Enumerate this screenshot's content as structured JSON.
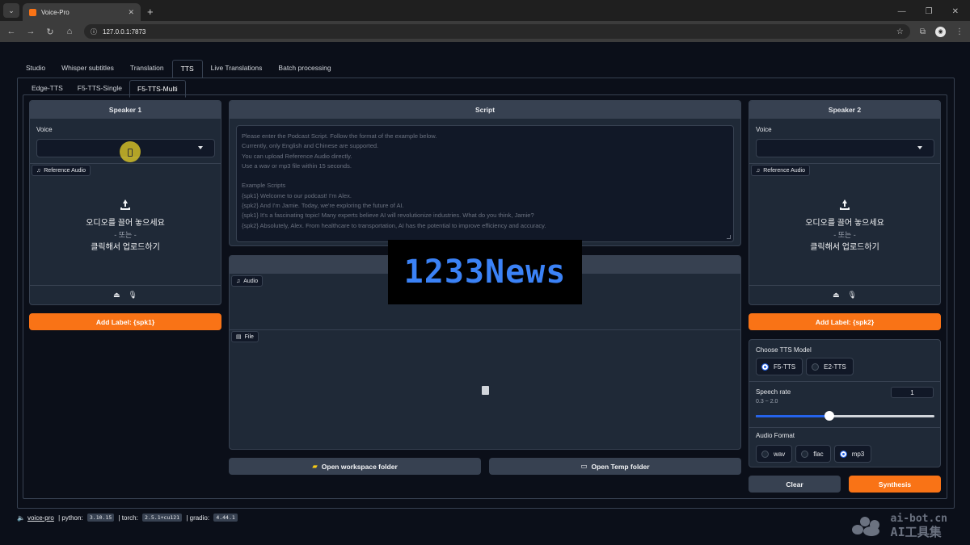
{
  "browser": {
    "tab_title": "Voice-Pro",
    "url": "127.0.0.1:7873"
  },
  "main_tabs": [
    {
      "label": "Studio"
    },
    {
      "label": "Whisper subtitles"
    },
    {
      "label": "Translation"
    },
    {
      "label": "TTS",
      "active": true
    },
    {
      "label": "Live Translations"
    },
    {
      "label": "Batch processing"
    }
  ],
  "sub_tabs": [
    {
      "label": "Edge-TTS"
    },
    {
      "label": "F5-TTS-Single"
    },
    {
      "label": "F5-TTS-Multi",
      "active": true
    }
  ],
  "speaker1": {
    "title": "Speaker 1",
    "voice_label": "Voice",
    "ref_audio_label": "Reference Audio",
    "drop_text": "오디오를 끌어 놓으세요",
    "or_text": "- 또는 -",
    "click_text": "클릭해서 업로드하기",
    "add_label_button": "Add Label: {spk1}"
  },
  "speaker2": {
    "title": "Speaker 2",
    "voice_label": "Voice",
    "ref_audio_label": "Reference Audio",
    "drop_text": "오디오를 끌어 놓으세요",
    "or_text": "- 또는 -",
    "click_text": "클릭해서 업로드하기",
    "add_label_button": "Add Label: {spk2}"
  },
  "script": {
    "title": "Script",
    "placeholder": "Please enter the Podcast Script. Follow the format of the example below.\nCurrently, only English and Chinese are supported.\nYou can upload Reference Audio directly.\nUse a wav or mp3 file within 15 seconds.\n\nExample Scripts\n{spk1} Welcome to our podcast! I'm Alex.\n{spk2} And I'm Jamie. Today, we're exploring the future of AI.\n{spk1} It's a fascinating topic! Many experts believe AI will revolutionize industries. What do you think, Jamie?\n{spk2} Absolutely, Alex. From healthcare to transportation, AI has the potential to improve efficiency and accuracy."
  },
  "output": {
    "audio_label": "Audio",
    "file_label": "File"
  },
  "overlay_watermark": "1233News",
  "buttons": {
    "open_workspace": "Open workspace folder",
    "open_temp": "Open Temp folder",
    "clear": "Clear",
    "synthesis": "Synthesis"
  },
  "settings": {
    "model_label": "Choose TTS Model",
    "models": [
      {
        "label": "F5-TTS",
        "selected": true
      },
      {
        "label": "E2-TTS",
        "selected": false
      }
    ],
    "speech_rate_label": "Speech rate",
    "speech_rate_range": "0.3 ~ 2.0",
    "speech_rate_value": "1",
    "speech_rate_min": 0.3,
    "speech_rate_max": 2.0,
    "audio_format_label": "Audio Format",
    "formats": [
      {
        "label": "wav",
        "selected": false
      },
      {
        "label": "flac",
        "selected": false
      },
      {
        "label": "mp3",
        "selected": true
      }
    ]
  },
  "footer": {
    "app_link": "voice-pro",
    "python_label": " | python: ",
    "python_version": "3.10.15",
    "torch_label": " | torch: ",
    "torch_version": "2.5.1+cu121",
    "gradio_label": " | gradio: ",
    "gradio_version": "4.44.1"
  },
  "brand": {
    "line1": "ai-bot.cn",
    "line2": "AI工具集"
  },
  "colors": {
    "accent_orange": "#f97316",
    "radio_blue": "#2563eb",
    "panel_bg": "#1f2937",
    "page_bg": "#0b0f19"
  }
}
